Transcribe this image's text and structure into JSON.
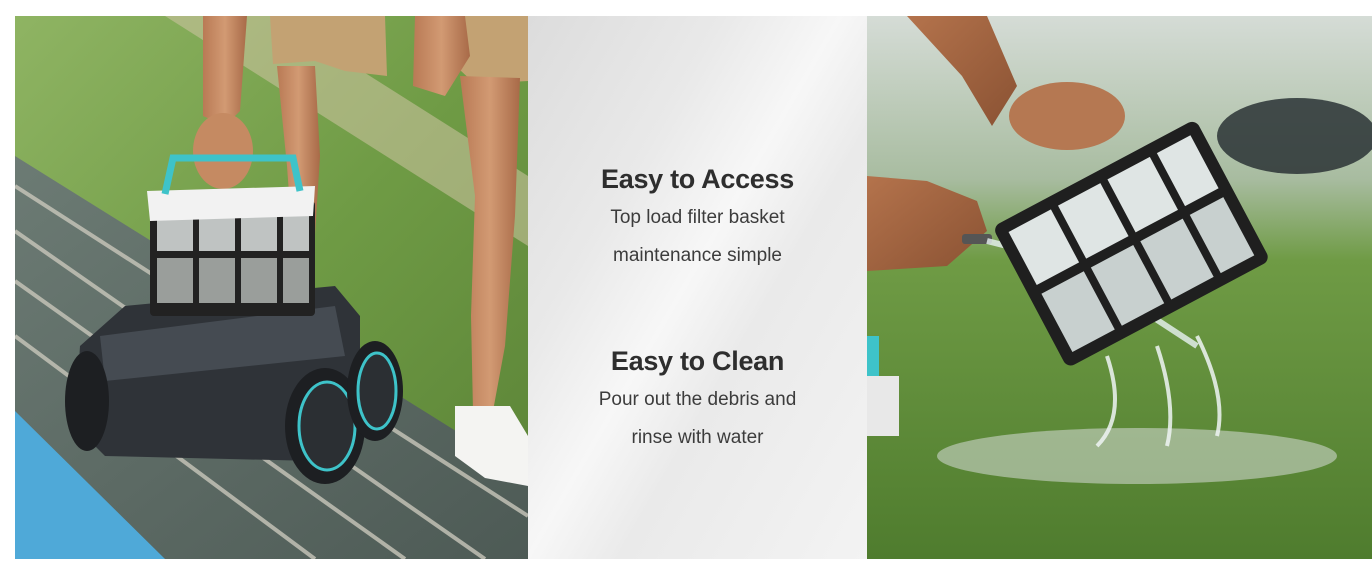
{
  "features": [
    {
      "title": "Easy to Access",
      "description": "Top load filter basket\nmaintenance simple"
    },
    {
      "title": "Easy to Clean",
      "description": "Pour out the debris and\nrinse with water"
    }
  ],
  "colors": {
    "grass": "#6f9b45",
    "pool_water": "#4fa9d8",
    "robot_body": "#2f3338",
    "accent_teal": "#3ec3c9",
    "panel_grey": "#ececec"
  }
}
